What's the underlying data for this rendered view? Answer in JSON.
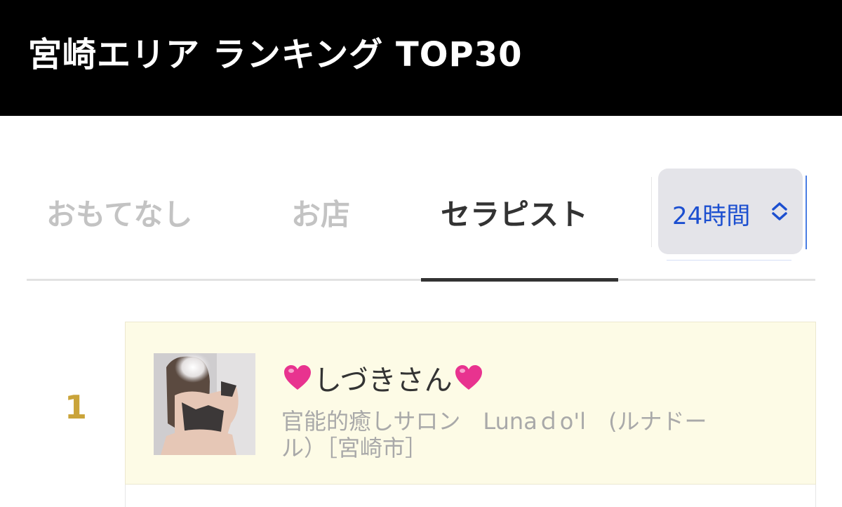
{
  "header": {
    "title": "宮崎エリア ランキング TOP30"
  },
  "tabs": [
    {
      "label": "おもてなし",
      "active": false
    },
    {
      "label": "お店",
      "active": false
    },
    {
      "label": "セラピスト",
      "active": true
    }
  ],
  "period_select": {
    "value": "24時間",
    "icon": "chevron-updown-icon"
  },
  "ranking": [
    {
      "rank": "1",
      "name": "しづきさん",
      "name_prefix_icon": "heart-icon",
      "name_suffix_icon": "heart-icon",
      "shop_line1": "官能的癒しサロン　Lunaｄo'l　(ルナドー",
      "shop_line2": "ル）［宮崎市］"
    }
  ],
  "colors": {
    "header_bg": "#000000",
    "rank_gold": "#caa43a",
    "select_text": "#1c4fd0",
    "card_bg": "#fdfbe6",
    "heart": "#e8338f"
  }
}
